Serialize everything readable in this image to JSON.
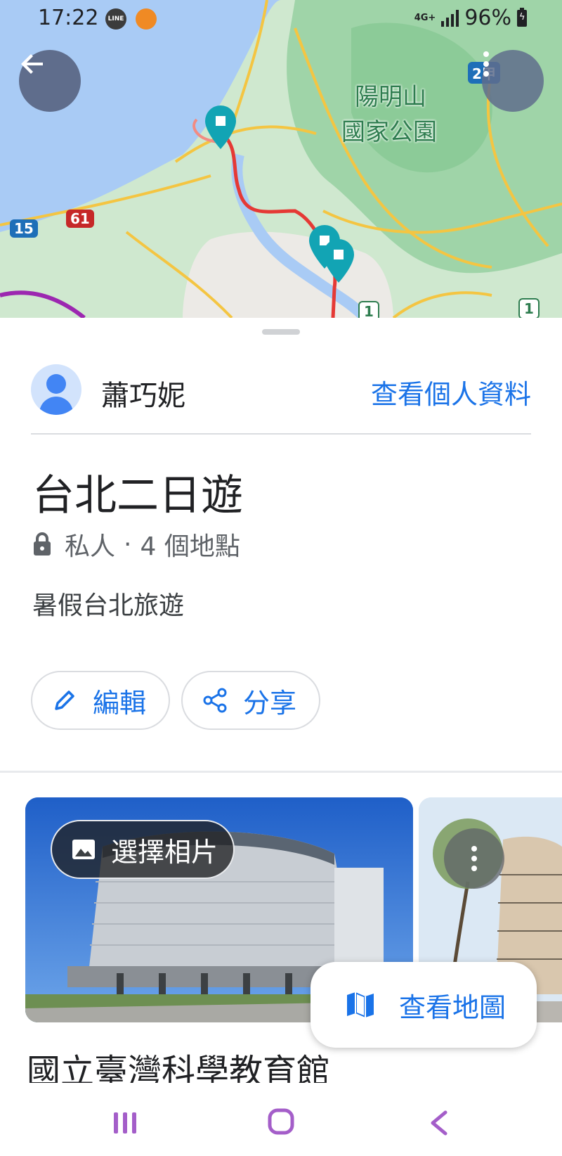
{
  "status_bar": {
    "time": "17:22",
    "network": "4G+",
    "battery_percent": "96%"
  },
  "map": {
    "back_icon": "arrow-back-icon",
    "more_icon": "more-vert-icon",
    "park_label_line1": "陽明山",
    "park_label_line2": "國家公園",
    "route_shields": [
      "15",
      "61",
      "2甲",
      "1",
      "1"
    ]
  },
  "sheet": {
    "owner_name": "蕭巧妮",
    "view_profile": "查看個人資料",
    "list_title": "台北二日遊",
    "visibility": "私人",
    "separator": "·",
    "place_count": "4 個地點",
    "description": "暑假台北旅遊",
    "edit_label": "編輯",
    "share_label": "分享",
    "choose_photo_label": "選擇相片",
    "view_map_label": "查看地圖",
    "place_title": "國立臺灣科學教育館"
  },
  "colors": {
    "accent": "#1a73e8",
    "route": "#e53935",
    "pin": "#12a4b4"
  }
}
